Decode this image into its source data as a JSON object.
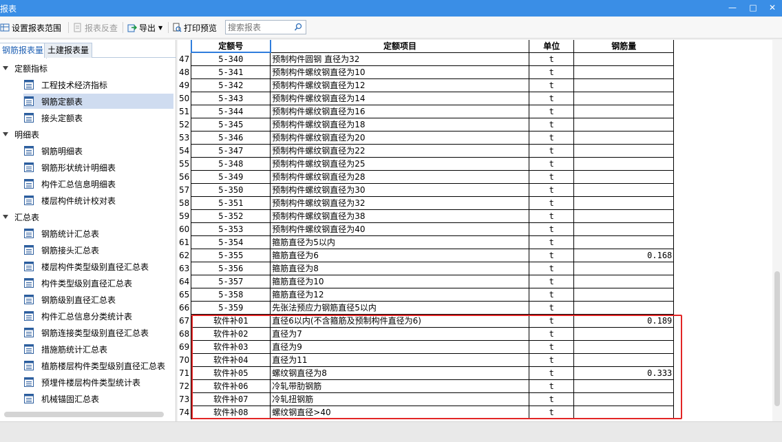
{
  "window": {
    "title": "报表"
  },
  "toolbar": {
    "set_range": "设置报表范围",
    "reverse_check": "报表反查",
    "export": "导出",
    "print_preview": "打印预览",
    "search_placeholder": "搜索报表"
  },
  "tabs": [
    {
      "label": "钢筋报表量",
      "active": true
    },
    {
      "label": "土建报表量",
      "active": false
    }
  ],
  "tree": {
    "groups": [
      {
        "label": "定额指标",
        "items": [
          "工程技术经济指标",
          "钢筋定额表",
          "接头定额表"
        ]
      },
      {
        "label": "明细表",
        "items": [
          "钢筋明细表",
          "钢筋形状统计明细表",
          "构件汇总信息明细表",
          "楼层构件统计校对表"
        ]
      },
      {
        "label": "汇总表",
        "items": [
          "钢筋统计汇总表",
          "钢筋接头汇总表",
          "楼层构件类型级别直径汇总表",
          "构件类型级别直径汇总表",
          "钢筋级别直径汇总表",
          "构件汇总信息分类统计表",
          "钢筋连接类型级别直径汇总表",
          "措施筋统计汇总表",
          "植筋楼层构件类型级别直径汇总表",
          "预埋件楼层构件类型统计表",
          "机械锚固汇总表"
        ]
      }
    ],
    "selected": "钢筋定额表"
  },
  "table": {
    "headers": [
      "定额号",
      "定额项目",
      "单位",
      "钢筋量"
    ],
    "rows": [
      [
        "47",
        "5-340",
        "预制构件圆钢 直径为32",
        "t",
        ""
      ],
      [
        "48",
        "5-341",
        "预制构件螺纹钢直径为10",
        "t",
        ""
      ],
      [
        "49",
        "5-342",
        "预制构件螺纹钢直径为12",
        "t",
        ""
      ],
      [
        "50",
        "5-343",
        "预制构件螺纹钢直径为14",
        "t",
        ""
      ],
      [
        "51",
        "5-344",
        "预制构件螺纹钢直径为16",
        "t",
        ""
      ],
      [
        "52",
        "5-345",
        "预制构件螺纹钢直径为18",
        "t",
        ""
      ],
      [
        "53",
        "5-346",
        "预制构件螺纹钢直径为20",
        "t",
        ""
      ],
      [
        "54",
        "5-347",
        "预制构件螺纹钢直径为22",
        "t",
        ""
      ],
      [
        "55",
        "5-348",
        "预制构件螺纹钢直径为25",
        "t",
        ""
      ],
      [
        "56",
        "5-349",
        "预制构件螺纹钢直径为28",
        "t",
        ""
      ],
      [
        "57",
        "5-350",
        "预制构件螺纹钢直径为30",
        "t",
        ""
      ],
      [
        "58",
        "5-351",
        "预制构件螺纹钢直径为32",
        "t",
        ""
      ],
      [
        "59",
        "5-352",
        "预制构件螺纹钢直径为38",
        "t",
        ""
      ],
      [
        "60",
        "5-353",
        "预制构件螺纹钢直径为40",
        "t",
        ""
      ],
      [
        "61",
        "5-354",
        "箍筋直径为5以内",
        "t",
        ""
      ],
      [
        "62",
        "5-355",
        "箍筋直径为6",
        "t",
        "0.168"
      ],
      [
        "63",
        "5-356",
        "箍筋直径为8",
        "t",
        ""
      ],
      [
        "64",
        "5-357",
        "箍筋直径为10",
        "t",
        ""
      ],
      [
        "65",
        "5-358",
        "箍筋直径为12",
        "t",
        ""
      ],
      [
        "66",
        "5-359",
        "先张法预应力钢筋直径5以内",
        "t",
        ""
      ],
      [
        "67",
        "软件补01",
        "直径6以内(不含箍筋及预制构件直径为6)",
        "t",
        "0.189"
      ],
      [
        "68",
        "软件补02",
        "直径为7",
        "t",
        ""
      ],
      [
        "69",
        "软件补03",
        "直径为9",
        "t",
        ""
      ],
      [
        "70",
        "软件补04",
        "直径为11",
        "t",
        ""
      ],
      [
        "71",
        "软件补05",
        "螺纹钢直径为8",
        "t",
        "0.333"
      ],
      [
        "72",
        "软件补06",
        "冷轧带肋钢筋",
        "t",
        ""
      ],
      [
        "73",
        "软件补07",
        "冷轧扭钢筋",
        "t",
        ""
      ],
      [
        "74",
        "软件补08",
        "螺纹钢直径>40",
        "t",
        ""
      ]
    ]
  },
  "colors": {
    "titlebar": "#3a8ee6",
    "highlight_box": "#e22525",
    "selected_item": "#cfdcf0"
  }
}
